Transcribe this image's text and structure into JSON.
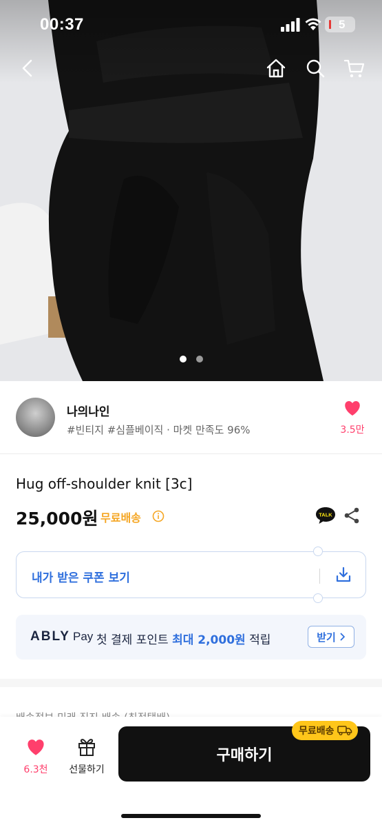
{
  "status_bar": {
    "time": "00:37",
    "battery": "5"
  },
  "nav": {
    "icons": [
      "back-icon",
      "home-icon",
      "search-icon",
      "cart-icon"
    ]
  },
  "hero": {
    "page_count": 2,
    "active_page": 1
  },
  "seller": {
    "name": "나의나인",
    "tags": "#빈티지 #심플베이직 · 마켓 만족도 96%",
    "like_count": "3.5만"
  },
  "product": {
    "title": "Hug off-shoulder knit [3c]",
    "price": "25,000원",
    "free_shipping": "무료배송"
  },
  "coupon": {
    "label": "내가 받은 쿠폰 보기"
  },
  "ably_pay": {
    "logo": "ABLY",
    "pay": "Pay",
    "text_prefix": "첫 결제 포인트 ",
    "text_highlight": "최대 2,000원",
    "text_suffix": " 적립",
    "button": "받기"
  },
  "delivery_partial": "배송정보         미래 직진 배송 (최적택배)",
  "bottom_bar": {
    "like_count": "6.3천",
    "gift_label": "선물하기",
    "buy_label": "구매하기",
    "buy_badge": "무료배송"
  },
  "colors": {
    "accent_pink": "#ff3f6c",
    "accent_blue": "#2f6fdd",
    "badge_yellow": "#ffc61a",
    "ship_orange": "#f5a623"
  }
}
